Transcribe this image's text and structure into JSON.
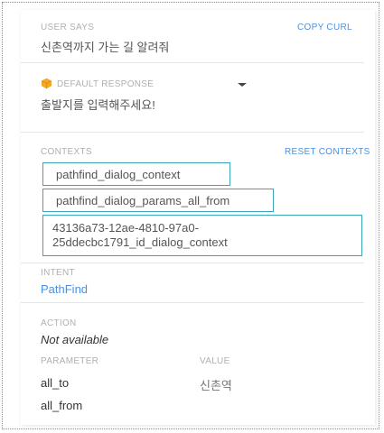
{
  "user_says": {
    "caption": "USER SAYS",
    "copy_curl": "COPY CURL",
    "text": "신촌역까지 가는 길 알려줘"
  },
  "response": {
    "caption": "DEFAULT RESPONSE",
    "icon": "chat-bubble-icon",
    "icon_color": "#f5a623",
    "text": "출발지를 입력해주세요!"
  },
  "contexts": {
    "caption": "CONTEXTS",
    "reset": "RESET CONTEXTS",
    "items": [
      "pathfind_dialog_context",
      "pathfind_dialog_params_all_from",
      "43136a73-12ae-4810-97a0-25ddecbc1791_id_dialog_context"
    ],
    "border_color": "#3aa6b9"
  },
  "intent": {
    "caption": "INTENT",
    "value": "PathFind"
  },
  "action": {
    "caption": "ACTION",
    "value": "Not available"
  },
  "parameters": {
    "col_parameter": "PARAMETER",
    "col_value": "VALUE",
    "rows": [
      {
        "name": "all_to",
        "value": "신촌역"
      },
      {
        "name": "all_from",
        "value": ""
      }
    ]
  }
}
